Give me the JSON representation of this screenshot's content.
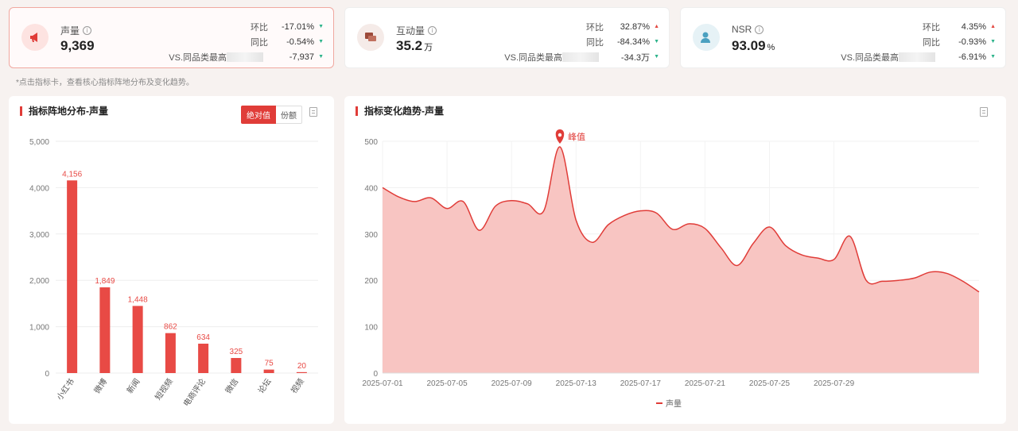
{
  "hint": "*点击指标卡，查看核心指标阵地分布及变化趋势。",
  "cards": [
    {
      "title": "声量",
      "value": "9,369",
      "unit": "",
      "color": "#e03c38",
      "rows": [
        {
          "label": "环比",
          "value": "-17.01%",
          "dir": "down"
        },
        {
          "label": "同比",
          "value": "-0.54%",
          "dir": "down"
        },
        {
          "label": "VS.同品类最高",
          "value": "-7,937",
          "dir": "down"
        }
      ]
    },
    {
      "title": "互动量",
      "value": "35.2",
      "unit": "万",
      "color": "#b05a4a",
      "rows": [
        {
          "label": "环比",
          "value": "32.87%",
          "dir": "up"
        },
        {
          "label": "同比",
          "value": "-84.34%",
          "dir": "down"
        },
        {
          "label": "VS.同品类最高",
          "value": "-34.3万",
          "dir": "down"
        }
      ]
    },
    {
      "title": "NSR",
      "value": "93.09",
      "unit": "%",
      "color": "#4aa0c0",
      "rows": [
        {
          "label": "环比",
          "value": "4.35%",
          "dir": "up"
        },
        {
          "label": "同比",
          "value": "-0.93%",
          "dir": "down"
        },
        {
          "label": "VS.同品类最高",
          "value": "-6.91%",
          "dir": "down"
        }
      ]
    }
  ],
  "left_panel": {
    "title": "指标阵地分布-声量",
    "toggle_on": "绝对值",
    "toggle_off": "份额"
  },
  "right_panel": {
    "title": "指标变化趋势-声量",
    "peak_label": "峰值",
    "legend": "声量"
  },
  "chart_data": [
    {
      "type": "bar",
      "categories": [
        "小红书",
        "微博",
        "新闻",
        "短视频",
        "电商评论",
        "微信",
        "论坛",
        "视频"
      ],
      "values": [
        4156,
        1849,
        1448,
        862,
        634,
        325,
        75,
        20
      ],
      "value_labels": [
        "4,156",
        "1,849",
        "1,448",
        "862",
        "634",
        "325",
        "75",
        "20"
      ],
      "ylim": [
        0,
        5000
      ],
      "yticks": [
        "0",
        "1,000",
        "2,000",
        "3,000",
        "4,000",
        "5,000"
      ],
      "color": "#e84a45"
    },
    {
      "type": "area",
      "series": [
        {
          "name": "声量",
          "values": [
            400,
            380,
            370,
            378,
            355,
            370,
            308,
            360,
            372,
            365,
            350,
            488,
            330,
            282,
            320,
            340,
            350,
            345,
            310,
            322,
            312,
            270,
            232,
            280,
            315,
            275,
            255,
            248,
            245,
            295,
            200,
            198,
            200,
            205,
            218,
            215,
            198,
            175
          ]
        }
      ],
      "x_ticks": [
        "2025-07-01",
        "2025-07-05",
        "2025-07-09",
        "2025-07-13",
        "2025-07-17",
        "2025-07-21",
        "2025-07-25",
        "2025-07-29"
      ],
      "ylim": [
        0,
        500
      ],
      "yticks": [
        "0",
        "100",
        "200",
        "300",
        "400",
        "500"
      ],
      "color": "#e03c38",
      "fill": "#f8c5c2"
    }
  ]
}
